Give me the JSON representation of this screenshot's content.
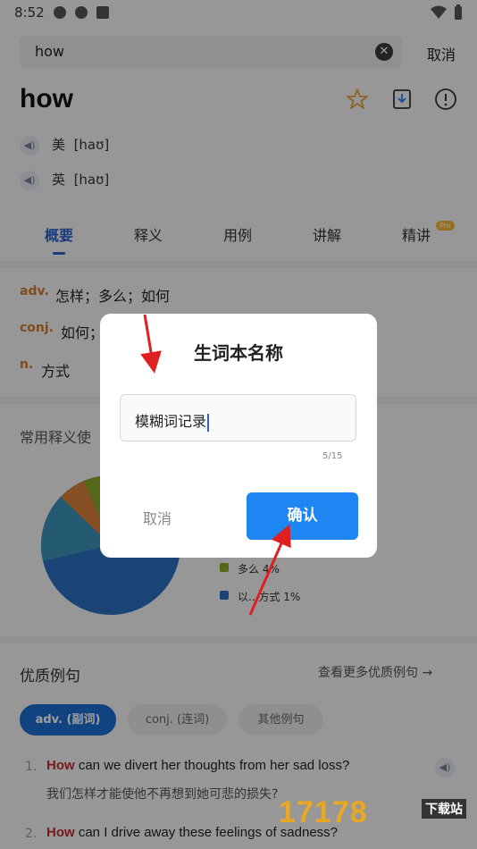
{
  "status_bar": {
    "time": "8:52"
  },
  "search": {
    "value": "how",
    "cancel_label": "取消"
  },
  "word": {
    "headword": "how",
    "pronunciations": [
      {
        "region": "美",
        "ipa": "[haʊ]"
      },
      {
        "region": "英",
        "ipa": "[haʊ]"
      }
    ]
  },
  "tabs": [
    {
      "label": "概要"
    },
    {
      "label": "释义"
    },
    {
      "label": "用例"
    },
    {
      "label": "讲解"
    },
    {
      "label": "精讲",
      "badge": "Pro"
    }
  ],
  "definitions": [
    {
      "pos": "adv.",
      "text": "怎样；多么；如何"
    },
    {
      "pos": "conj.",
      "text": "如何；"
    },
    {
      "pos": "n.",
      "text": "方式"
    }
  ],
  "usage": {
    "title": "常用释义使",
    "legend": [
      {
        "label": "多么 4%",
        "color": "#8aa629"
      },
      {
        "label": "以...方式 1%",
        "color": "#2a6fbd"
      }
    ]
  },
  "examples": {
    "title": "优质例句",
    "more_label": "查看更多优质例句",
    "chips": [
      {
        "label": "adv. (副词)",
        "active": true
      },
      {
        "label": "conj. (连词)",
        "active": false
      },
      {
        "label": "其他例句",
        "active": false
      }
    ],
    "items": [
      {
        "num": "1.",
        "highlight": "How",
        "rest": " can we divert her thoughts from her sad loss?",
        "zh": "我们怎样才能使他不再想到她可悲的损失?"
      },
      {
        "num": "2.",
        "highlight": "How",
        "rest": " can I drive away these feelings of sadness?",
        "zh": ""
      }
    ]
  },
  "dialog": {
    "title": "生词本名称",
    "input_value": "模糊词记录",
    "counter": "5/15",
    "cancel_label": "取消",
    "confirm_label": "确认"
  },
  "watermark": {
    "number": "17178",
    "site": "下载站"
  }
}
